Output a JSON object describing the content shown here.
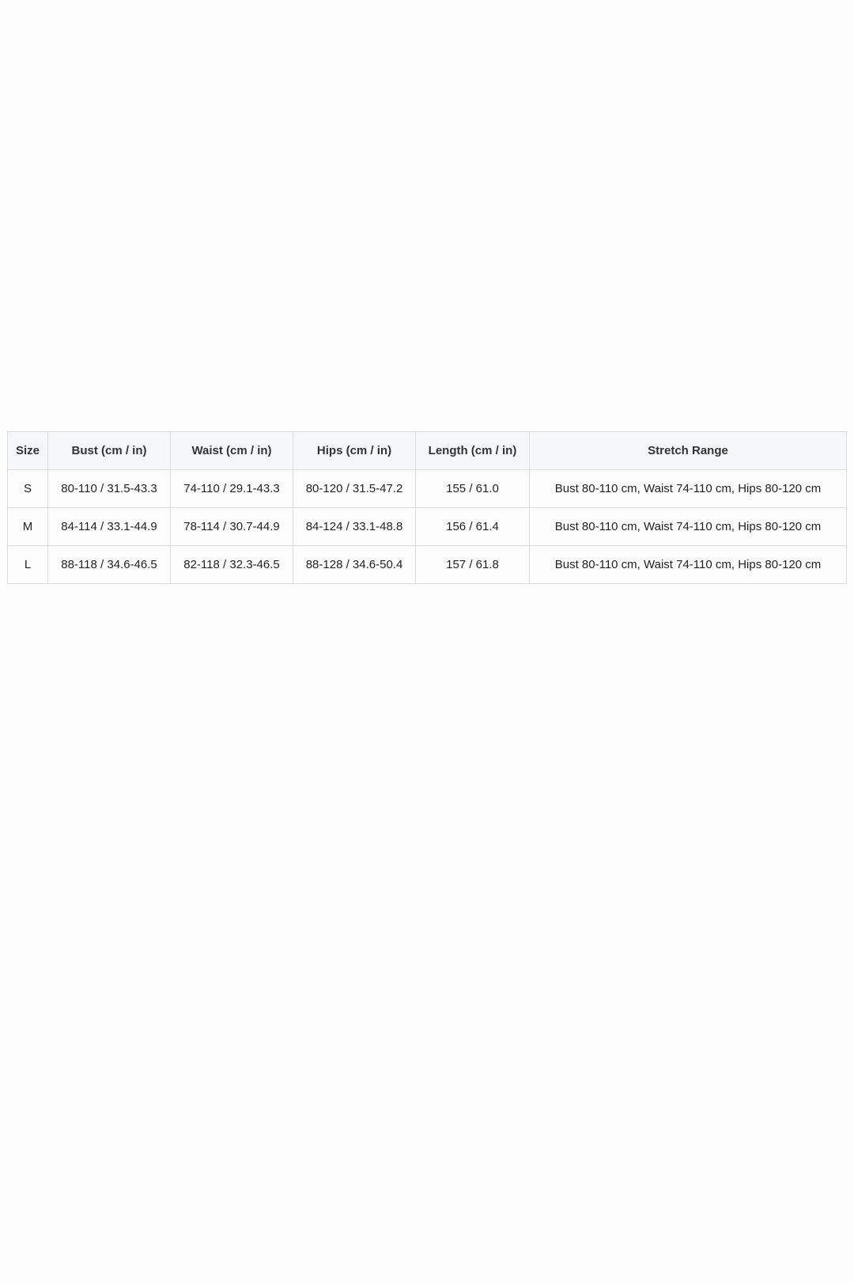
{
  "size_chart": {
    "headers": [
      "Size",
      "Bust (cm / in)",
      "Waist (cm / in)",
      "Hips (cm / in)",
      "Length (cm / in)",
      "Stretch Range"
    ],
    "rows": [
      [
        "S",
        "80-110 / 31.5-43.3",
        "74-110 / 29.1-43.3",
        "80-120 / 31.5-47.2",
        "155 / 61.0",
        "Bust 80-110 cm, Waist 74-110 cm, Hips 80-120 cm"
      ],
      [
        "M",
        "84-114 / 33.1-44.9",
        "78-114 / 30.7-44.9",
        "84-124 / 33.1-48.8",
        "156 / 61.4",
        "Bust 80-110 cm, Waist 74-110 cm, Hips 80-120 cm"
      ],
      [
        "L",
        "88-118 / 34.6-46.5",
        "82-118 / 32.3-46.5",
        "88-128 / 34.6-50.4",
        "157 / 61.8",
        "Bust 80-110 cm, Waist 74-110 cm, Hips 80-120 cm"
      ]
    ]
  },
  "colors": {
    "header_background": "#f6f7f9",
    "border": "#dcdcdc",
    "text": "#222222",
    "page_background": "#fdfdfd"
  }
}
